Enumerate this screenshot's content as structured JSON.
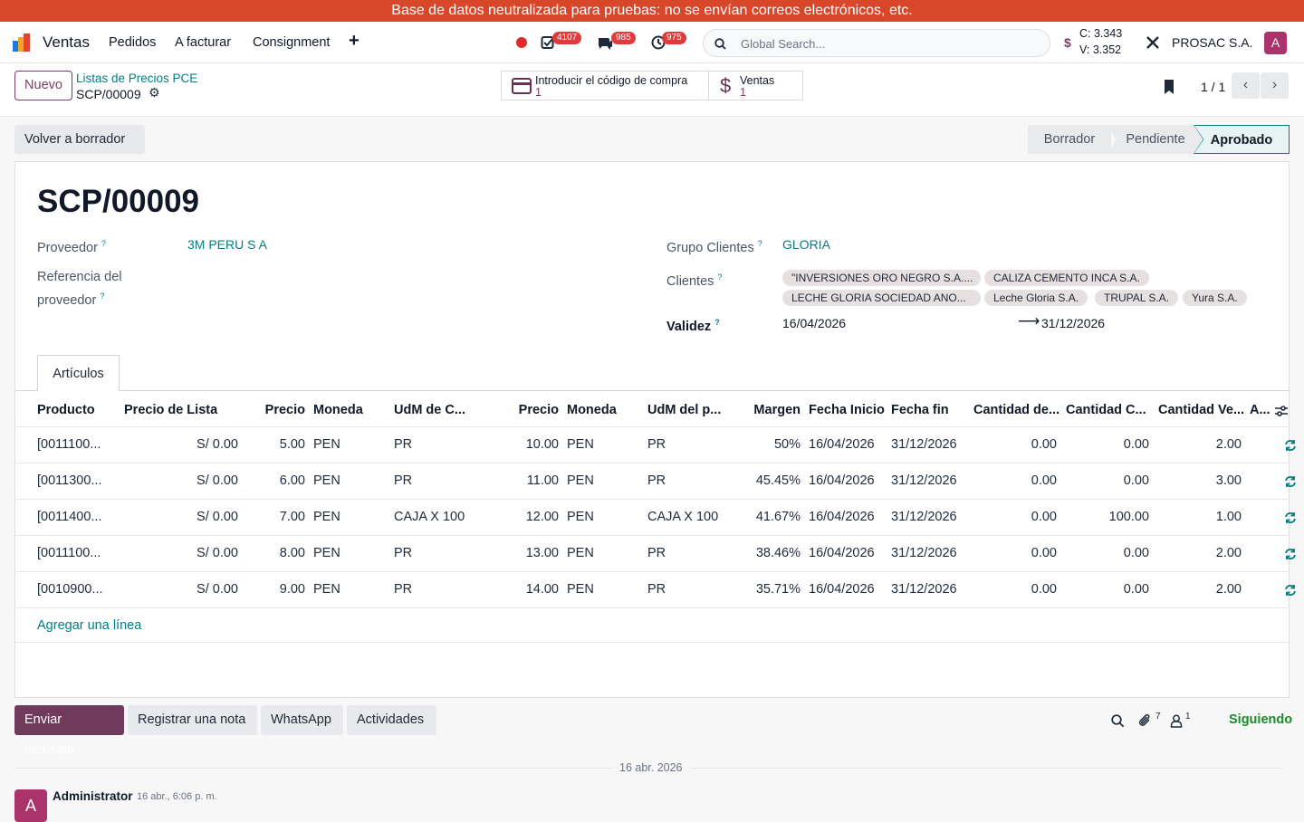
{
  "banner": "Base de datos neutralizada para pruebas: no se envían correos electrónicos, etc.",
  "nav": {
    "app_name": "Ventas",
    "menu": [
      "Pedidos",
      "A facturar",
      "Consignment"
    ],
    "badges": {
      "activities": "4107",
      "messages": "985",
      "clock": "975"
    },
    "search_placeholder": "Global Search...",
    "rate_c": "C: 3.343",
    "rate_v": "V: 3.352",
    "company": "PROSAC S.A.",
    "user_initial": "A"
  },
  "control": {
    "new_label": "Nuevo",
    "breadcrumb_parent": "Listas de Precios PCE",
    "breadcrumb_current": "SCP/00009",
    "smart_buttons": [
      {
        "label": "Introducir el código de compra",
        "count": "1"
      },
      {
        "label": "Ventas",
        "count": "1"
      }
    ],
    "pager": "1 / 1"
  },
  "status": {
    "reset_label": "Volver a borrador",
    "stages": [
      "Borrador",
      "Pendiente",
      "Aprobado"
    ],
    "active_stage": "Aprobado"
  },
  "form": {
    "title": "SCP/00009",
    "proveedor_label": "Proveedor",
    "proveedor": "3M PERU S A",
    "ref_label_1": "Referencia del",
    "ref_label_2": "proveedor",
    "grupo_label": "Grupo Clientes",
    "grupo": "GLORIA",
    "clientes_label": "Clientes",
    "clientes": [
      "\"INVERSIONES ORO NEGRO S.A....",
      "CALIZA CEMENTO INCA S.A.",
      "LECHE GLORIA SOCIEDAD ANO...",
      "Leche Gloria S.A.",
      "TRUPAL S.A.",
      "Yura S.A."
    ],
    "validez_label": "Validez",
    "validez_from": "16/04/2026",
    "validez_to": "31/12/2026"
  },
  "tab_label": "Artículos",
  "table": {
    "headers": [
      "Producto",
      "Precio de Lista",
      "Precio",
      "Moneda",
      "UdM de C...",
      "Precio",
      "Moneda",
      "UdM del p...",
      "Margen",
      "Fecha Inicio",
      "Fecha fin",
      "Cantidad de...",
      "Cantidad C...",
      "Cantidad Ve...",
      "A..."
    ],
    "rows": [
      [
        "[0011100...",
        "S/ 0.00",
        "5.00",
        "PEN",
        "PR",
        "10.00",
        "PEN",
        "PR",
        "50%",
        "16/04/2026",
        "31/12/2026",
        "0.00",
        "0.00",
        "2.00"
      ],
      [
        "[0011300...",
        "S/ 0.00",
        "6.00",
        "PEN",
        "PR",
        "11.00",
        "PEN",
        "PR",
        "45.45%",
        "16/04/2026",
        "31/12/2026",
        "0.00",
        "0.00",
        "3.00"
      ],
      [
        "[0011400...",
        "S/ 0.00",
        "7.00",
        "PEN",
        "CAJA X 100",
        "12.00",
        "PEN",
        "CAJA X 100",
        "41.67%",
        "16/04/2026",
        "31/12/2026",
        "0.00",
        "100.00",
        "1.00"
      ],
      [
        "[0011100...",
        "S/ 0.00",
        "8.00",
        "PEN",
        "PR",
        "13.00",
        "PEN",
        "PR",
        "38.46%",
        "16/04/2026",
        "31/12/2026",
        "0.00",
        "0.00",
        "2.00"
      ],
      [
        "[0010900...",
        "S/ 0.00",
        "9.00",
        "PEN",
        "PR",
        "14.00",
        "PEN",
        "PR",
        "35.71%",
        "16/04/2026",
        "31/12/2026",
        "0.00",
        "0.00",
        "2.00"
      ]
    ],
    "add_line": "Agregar una línea"
  },
  "chatter": {
    "send": "Enviar mensaje",
    "note": "Registrar una nota",
    "whatsapp": "WhatsApp",
    "activities": "Actividades",
    "attachments": "7",
    "followers": "1",
    "following": "Siguiendo",
    "date": "16 abr. 2026",
    "author": "Administrator",
    "time": "16 abr., 6:06 p. m.",
    "author_initial": "A"
  },
  "colors": {
    "brand": "#7a3f62",
    "link": "#017e84",
    "banner": "#d9472b",
    "badge": "#e03b3b"
  }
}
